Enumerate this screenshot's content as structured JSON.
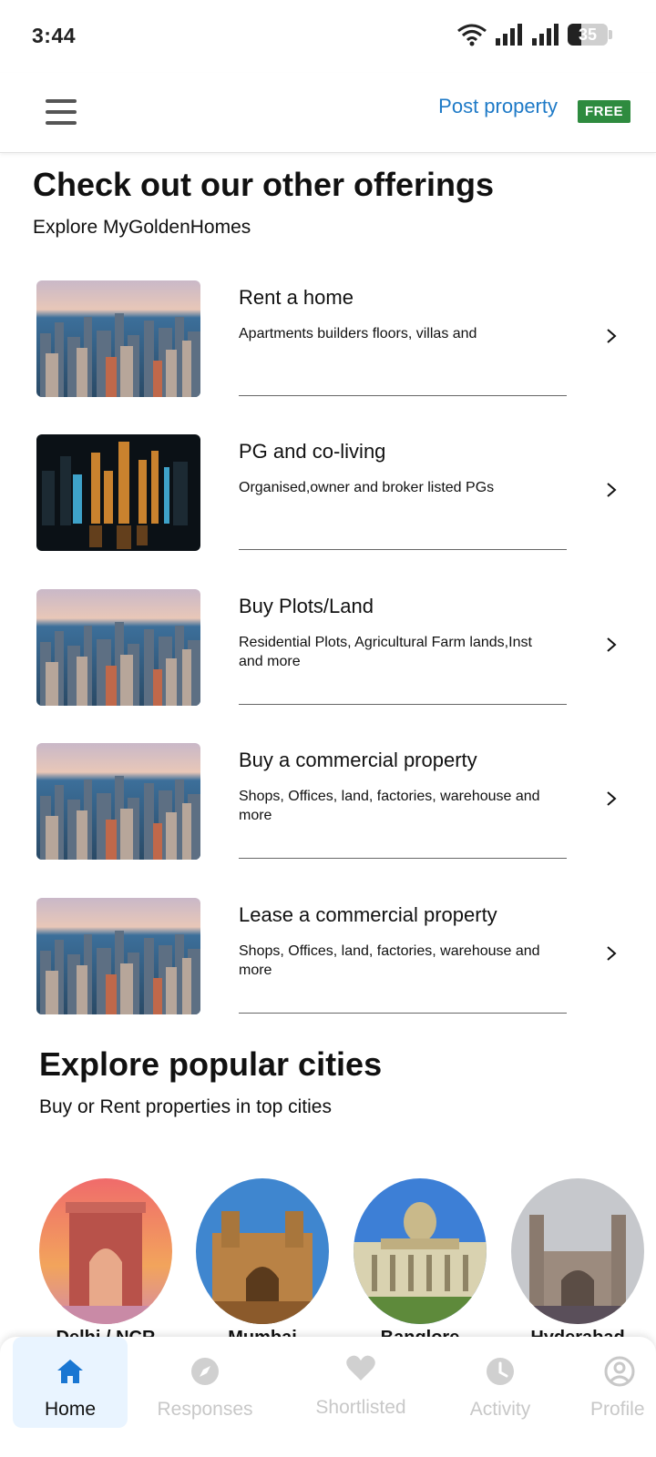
{
  "status_bar": {
    "time": "3:44",
    "battery": "35",
    "battery_level": 0.35
  },
  "header": {
    "post_property": "Post property",
    "free_badge": "FREE"
  },
  "offerings": {
    "title": "Check out our other offerings",
    "subtitle": "Explore MyGoldenHomes",
    "items": [
      {
        "title": "Rent a home",
        "desc": "Apartments builders floors, villas and"
      },
      {
        "title": "PG and co-living",
        "desc": "Organised,owner and broker listed PGs"
      },
      {
        "title": "Buy Plots/Land",
        "desc": "Residential Plots, Agricultural Farm lands,Inst and more"
      },
      {
        "title": "Buy a commercial property",
        "desc": "Shops, Offices, land, factories, warehouse and more"
      },
      {
        "title": "Lease a commercial property",
        "desc": "Shops, Offices, land, factories, warehouse and more"
      }
    ]
  },
  "cities": {
    "title": "Explore popular cities",
    "subtitle": "Buy or Rent properties in top cities",
    "items": [
      {
        "label": "Delhi / NCR"
      },
      {
        "label": "Mumbai"
      },
      {
        "label": "Banglore"
      },
      {
        "label": "Hyderabad"
      }
    ]
  },
  "bottom_nav": {
    "items": [
      {
        "label": "Home",
        "icon": "home-icon",
        "active": true
      },
      {
        "label": "Responses",
        "icon": "compass-icon",
        "active": false
      },
      {
        "label": "Shortlisted",
        "icon": "heart-icon",
        "active": false
      },
      {
        "label": "Activity",
        "icon": "clock-icon",
        "active": false
      },
      {
        "label": "Profile",
        "icon": "user-icon",
        "active": false
      }
    ]
  },
  "colors": {
    "accent": "#1e7ac7",
    "badge": "#2e8b3f",
    "active_nav_bg": "#e9f4ff"
  }
}
